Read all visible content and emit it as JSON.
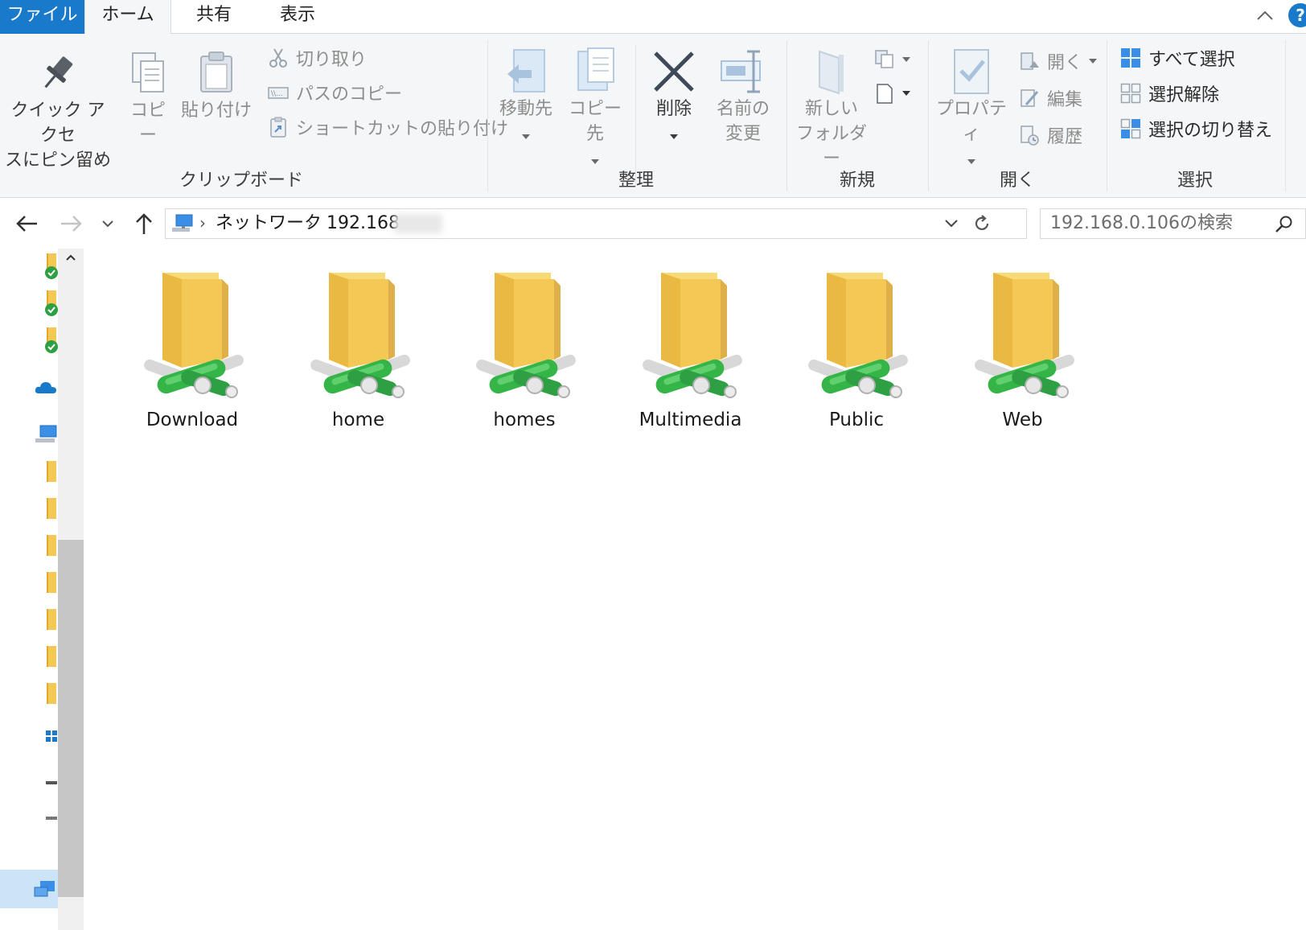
{
  "tabs": {
    "file": "ファイル",
    "home": "ホーム",
    "share": "共有",
    "view": "表示"
  },
  "ribbon": {
    "clipboard": {
      "pin_line1": "クイック アクセ",
      "pin_line2": "スにピン留め",
      "copy": "コピー",
      "paste": "貼り付け",
      "cut": "切り取り",
      "copy_path": "パスのコピー",
      "paste_shortcut": "ショートカットの貼り付け",
      "label": "クリップボード"
    },
    "organize": {
      "move_to": "移動先",
      "copy_to": "コピー先",
      "delete": "削除",
      "rename_line1": "名前の",
      "rename_line2": "変更",
      "label": "整理"
    },
    "new": {
      "new_folder_line1": "新しい",
      "new_folder_line2": "フォルダー",
      "label": "新規"
    },
    "open": {
      "properties": "プロパティ",
      "open": "開く",
      "edit": "編集",
      "history": "履歴",
      "label": "開く"
    },
    "select": {
      "select_all": "すべて選択",
      "select_none": "選択解除",
      "invert": "選択の切り替え",
      "label": "選択"
    }
  },
  "address": {
    "crumb_network": "ネットワーク",
    "crumb_host": "192.168"
  },
  "search": {
    "placeholder": "192.168.0.106の検索"
  },
  "folders": [
    {
      "name": "Download"
    },
    {
      "name": "home"
    },
    {
      "name": "homes"
    },
    {
      "name": "Multimedia"
    },
    {
      "name": "Public"
    },
    {
      "name": "Web"
    }
  ],
  "colors": {
    "accent": "#1979ca",
    "folder": "#f3c854",
    "share_pipe": "#35b447"
  },
  "icons": {
    "help": "?"
  }
}
